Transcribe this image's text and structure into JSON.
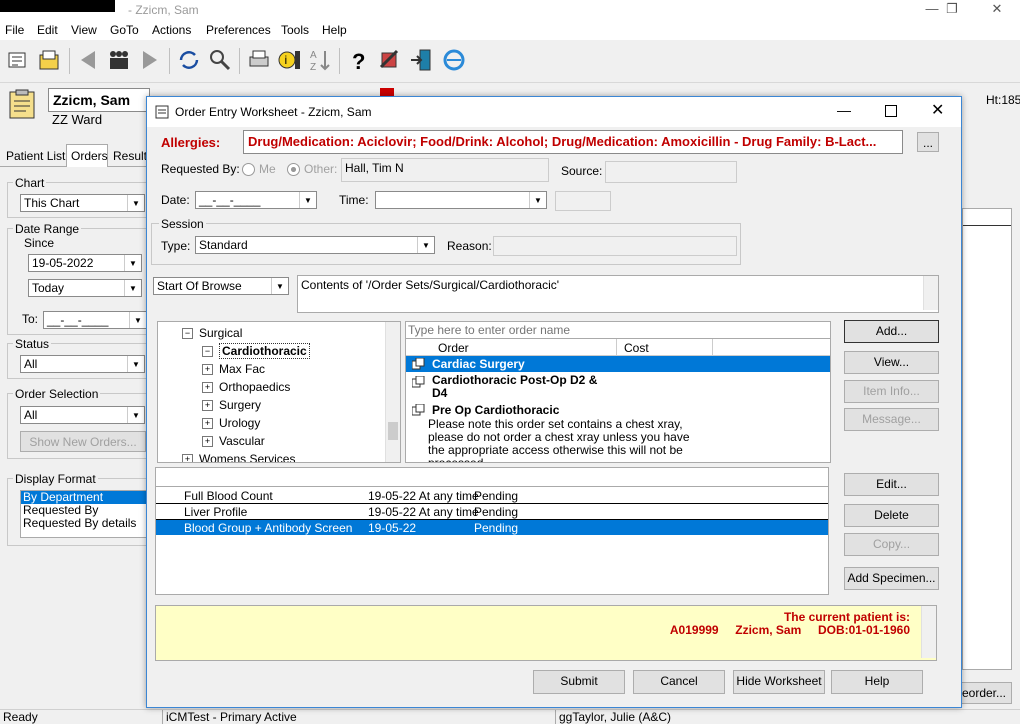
{
  "window": {
    "title": "- Zzicm, Sam"
  },
  "menu": [
    "File",
    "Edit",
    "View",
    "GoTo",
    "Actions",
    "Preferences",
    "Tools",
    "Help"
  ],
  "toolbar_icons": [
    "patient-list-icon",
    "open-chart-icon",
    "back-arrow-icon",
    "users-icon",
    "forward-arrow-icon",
    "refresh-icon",
    "search-icon",
    "print-icon",
    "alert-icon",
    "sort-icon",
    "help-icon",
    "tools-icon",
    "exit-icon",
    "browser-icon"
  ],
  "patient": {
    "name": "Zzicm, Sam",
    "ward": "ZZ Ward",
    "header_right": "Ht:185"
  },
  "left_panel": {
    "tabs": [
      "Patient List",
      "Orders",
      "Results"
    ],
    "chart_label": "Chart",
    "chart_value": "This Chart",
    "date_range_label": "Date Range",
    "since_label": "Since",
    "since_value": "19-05-2022",
    "today_value": "Today",
    "to_label": "To:",
    "to_value": "__-__-____",
    "status_label": "Status",
    "status_value": "All",
    "order_selection_label": "Order Selection",
    "order_selection_value": "All",
    "show_new_orders": "Show New Orders...",
    "display_format_label": "Display Format",
    "display_formats": [
      "By Department",
      "Requested By",
      "Requested By details"
    ]
  },
  "dialog": {
    "title": "Order Entry Worksheet - Zzicm, Sam",
    "allergies_label": "Allergies:",
    "allergies_text": "Drug/Medication: Aciclovir; Food/Drink: Alcohol; Drug/Medication: Amoxicillin - Drug Family: B-Lact...",
    "allergies_btn": "...",
    "requested_by_label": "Requested By:",
    "me_label": "Me",
    "other_label": "Other:",
    "requested_by_value": "Hall, Tim N",
    "source_label": "Source:",
    "date_label": "Date:",
    "date_value": "__-__-____",
    "time_label": "Time:",
    "session_label": "Session",
    "type_label": "Type:",
    "type_value": "Standard",
    "reason_label": "Reason:",
    "browse_value": "Start Of Browse",
    "contents_text": "Contents of '/Order Sets/Surgical/Cardiothoracic'",
    "tree": [
      {
        "label": "Surgical",
        "sign": "−",
        "level": 0
      },
      {
        "label": "Cardiothoracic",
        "sign": "−",
        "level": 1,
        "selected": true
      },
      {
        "label": "Max Fac",
        "sign": "+",
        "level": 1
      },
      {
        "label": "Orthopaedics",
        "sign": "+",
        "level": 1
      },
      {
        "label": "Surgery",
        "sign": "+",
        "level": 1
      },
      {
        "label": "Urology",
        "sign": "+",
        "level": 1
      },
      {
        "label": "Vascular",
        "sign": "+",
        "level": 1
      },
      {
        "label": "Womens Services",
        "sign": "+",
        "level": 0
      }
    ],
    "search_placeholder": "Type here to enter order name",
    "order_cols": [
      "Order",
      "Cost"
    ],
    "orders": [
      {
        "name": "Cardiac Surgery",
        "selected": true
      },
      {
        "name": "Cardiothoracic Post-Op D2 & D4"
      },
      {
        "name": "Pre Op Cardiothoracic"
      }
    ],
    "order_note": "Please note this order set contains a chest xray, please do not order a chest xray unless you have the appropriate access otherwise this will not be processed.",
    "side_buttons_top": [
      {
        "label": "Add...",
        "disabled": false
      },
      {
        "label": "View...",
        "disabled": false
      },
      {
        "label": "Item Info...",
        "disabled": true
      },
      {
        "label": "Message...",
        "disabled": true
      }
    ],
    "worksheet_rows": [
      {
        "name": "Full Blood Count",
        "date": "19-05-22 At any time",
        "status": "Pending"
      },
      {
        "name": "Liver Profile",
        "date": "19-05-22 At any time",
        "status": "Pending"
      },
      {
        "name": "Blood Group + Antibody Screen",
        "date": "19-05-22",
        "status": "Pending",
        "selected": true
      }
    ],
    "side_buttons_bottom": [
      {
        "label": "Edit...",
        "disabled": false
      },
      {
        "label": "Delete",
        "disabled": false
      },
      {
        "label": "Copy...",
        "disabled": true
      },
      {
        "label": "Add Specimen...",
        "disabled": false
      }
    ],
    "patient_info_line1": "The current patient is:",
    "patient_info_line2": "A019999     Zzicm, Sam     DOB:01-01-1960",
    "bottom_buttons": [
      "Submit",
      "Cancel",
      "Hide Worksheet",
      "Help"
    ]
  },
  "background": {
    "reorder_btn": "eorder..."
  },
  "statusbar": {
    "state": "Ready",
    "env": "iCMTest - Primary Active",
    "user": "ggTaylor, Julie  (A&C)"
  },
  "colors": {
    "selection": "#0078d7",
    "allergy_red": "#c00000",
    "info_bg": "#ffffc6"
  }
}
